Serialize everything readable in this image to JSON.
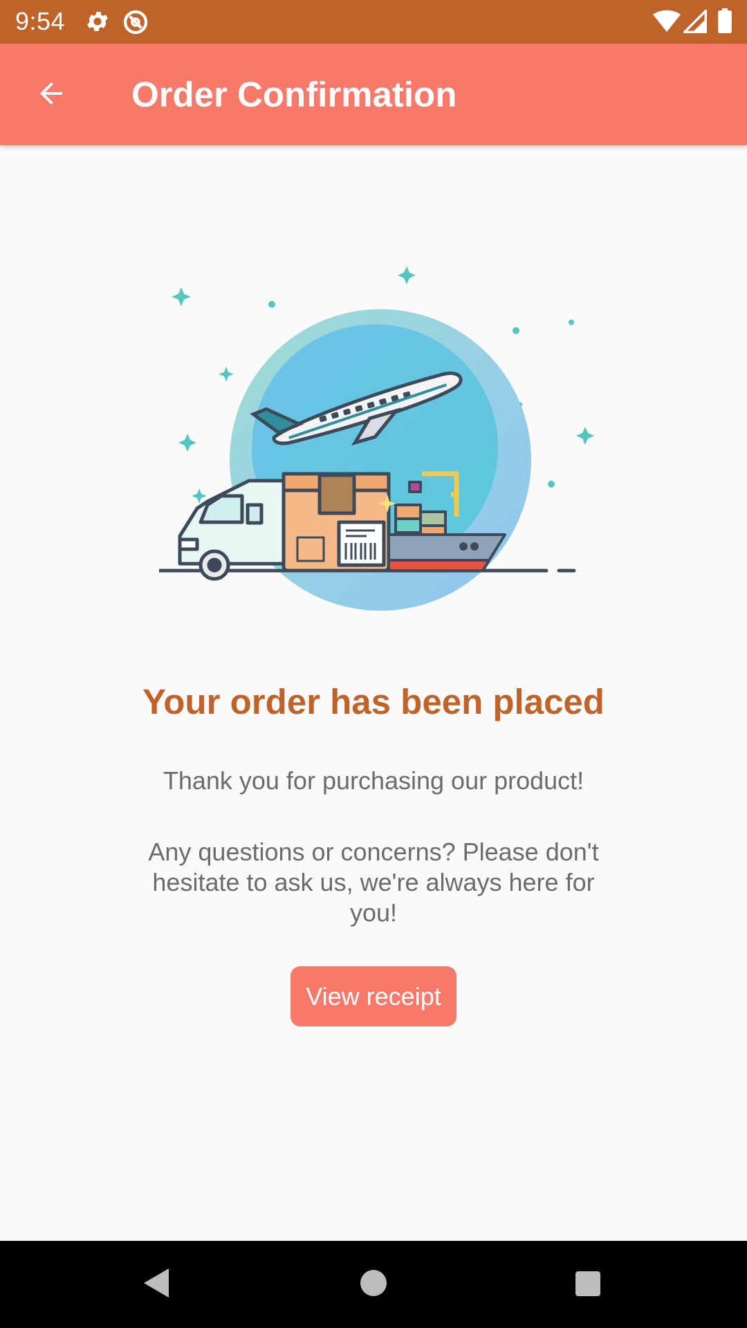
{
  "status_bar": {
    "time": "9:54",
    "icons": [
      "settings-icon",
      "vpn-key-icon",
      "wifi-icon",
      "signal-icon",
      "battery-icon"
    ]
  },
  "app_bar": {
    "title": "Order Confirmation",
    "back_icon": "arrow-back-icon",
    "color": "#f7796a"
  },
  "main": {
    "heading": "Your order has been placed",
    "thanks_text": "Thank you for purchasing our product!",
    "questions_text": "Any questions or concerns? Please don't hesitate to ask us, we're always here for you!",
    "receipt_button_label": "View receipt",
    "illustration": "shipping-illustration"
  },
  "nav_bar": {
    "buttons": [
      "back-triangle-icon",
      "home-circle-icon",
      "recents-square-icon"
    ]
  },
  "colors": {
    "status_bar": "#c0632a",
    "accent": "#f7796a",
    "heading": "#c0632a",
    "body_text": "#6b6b6b",
    "background": "#fafafa"
  }
}
